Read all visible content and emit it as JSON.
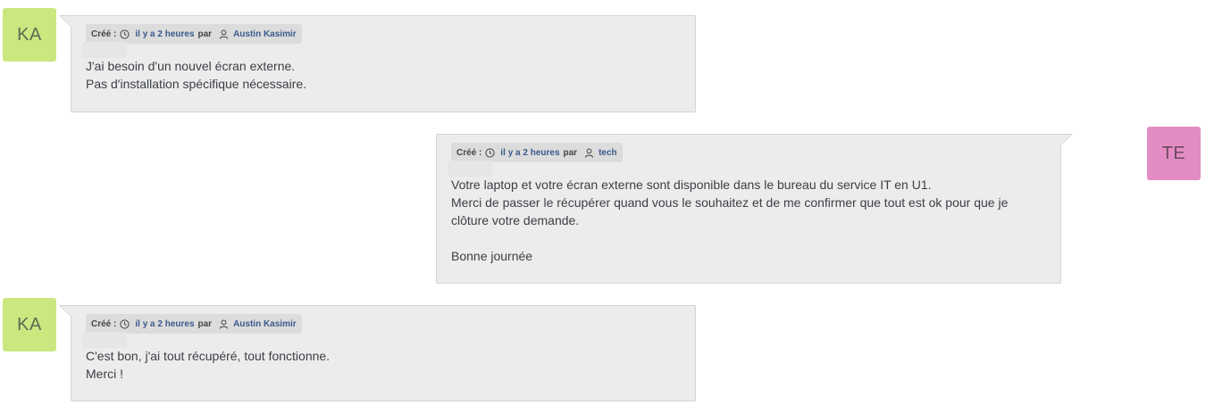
{
  "messages": [
    {
      "avatar_initials": "KA",
      "created_label": "Créé :",
      "time": "il y a 2 heures",
      "par": "par",
      "author": "Austin Kasimir",
      "lines": [
        "J'ai besoin d'un nouvel écran externe.",
        "Pas d'installation spécifique nécessaire."
      ]
    },
    {
      "avatar_initials": "TE",
      "created_label": "Créé :",
      "time": "il y a 2 heures",
      "par": "par",
      "author": "tech",
      "lines": [
        "Votre laptop et votre écran externe sont disponible dans le bureau du service IT en U1.",
        "Merci de passer le récupérer quand vous le souhaitez et de me confirmer que tout est ok pour que je",
        "clôture votre demande.",
        "",
        "Bonne journée"
      ]
    },
    {
      "avatar_initials": "KA",
      "created_label": "Créé :",
      "time": "il y a 2 heures",
      "par": "par",
      "author": "Austin Kasimir",
      "lines": [
        "C'est bon, j'ai tout récupéré, tout fonctionne.",
        "Merci !"
      ]
    }
  ],
  "colors": {
    "avatar_ka": "#cbe77f",
    "avatar_te": "#e38cc4",
    "bubble_bg": "#ececec",
    "link": "#3a5a8c"
  },
  "icons": [
    "clock-icon",
    "user-icon"
  ]
}
